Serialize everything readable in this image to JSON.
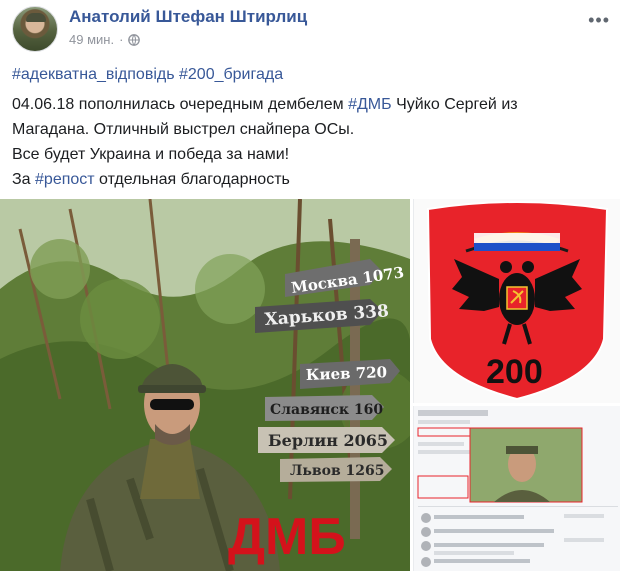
{
  "post": {
    "author": "Анатолий Штефан Штирлиц",
    "time": "49 мин.",
    "time_separator": "·",
    "privacy_icon": "globe-icon",
    "more_icon": "more-icon",
    "hashtag_1": "#адекватна_відповідь",
    "hashtag_2": "#200_бригада",
    "line1_prefix": "04.06.18 пополнилась очередным дембелем ",
    "line1_tag": "#ДМБ",
    "line1_suffix": " Чуйко Сергей из",
    "line2": "Магадана. Отличный выстрел снайпера ОСы.",
    "line3": "Все будет Украина и победа за нами!",
    "line3_flag": "ukraine-flag-icon",
    "line4_prefix": "За ",
    "line4_tag": "#репост",
    "line4_suffix": " отдельная благодарность"
  },
  "photos": {
    "main": {
      "signs": [
        "Москва 1073",
        "Харьков 338",
        "Киев 720",
        "Славянск 160",
        "Берлин 2065",
        "Львов 1265"
      ],
      "overlay": "ДМБ"
    },
    "emblem": {
      "number": "200"
    },
    "screenshot": {
      "label": "social-profile-screenshot"
    }
  },
  "colors": {
    "link": "#385898",
    "text": "#1c1e21",
    "meta": "#90949c",
    "emblem_red": "#e8232a",
    "overlay_red": "#d4121b"
  }
}
